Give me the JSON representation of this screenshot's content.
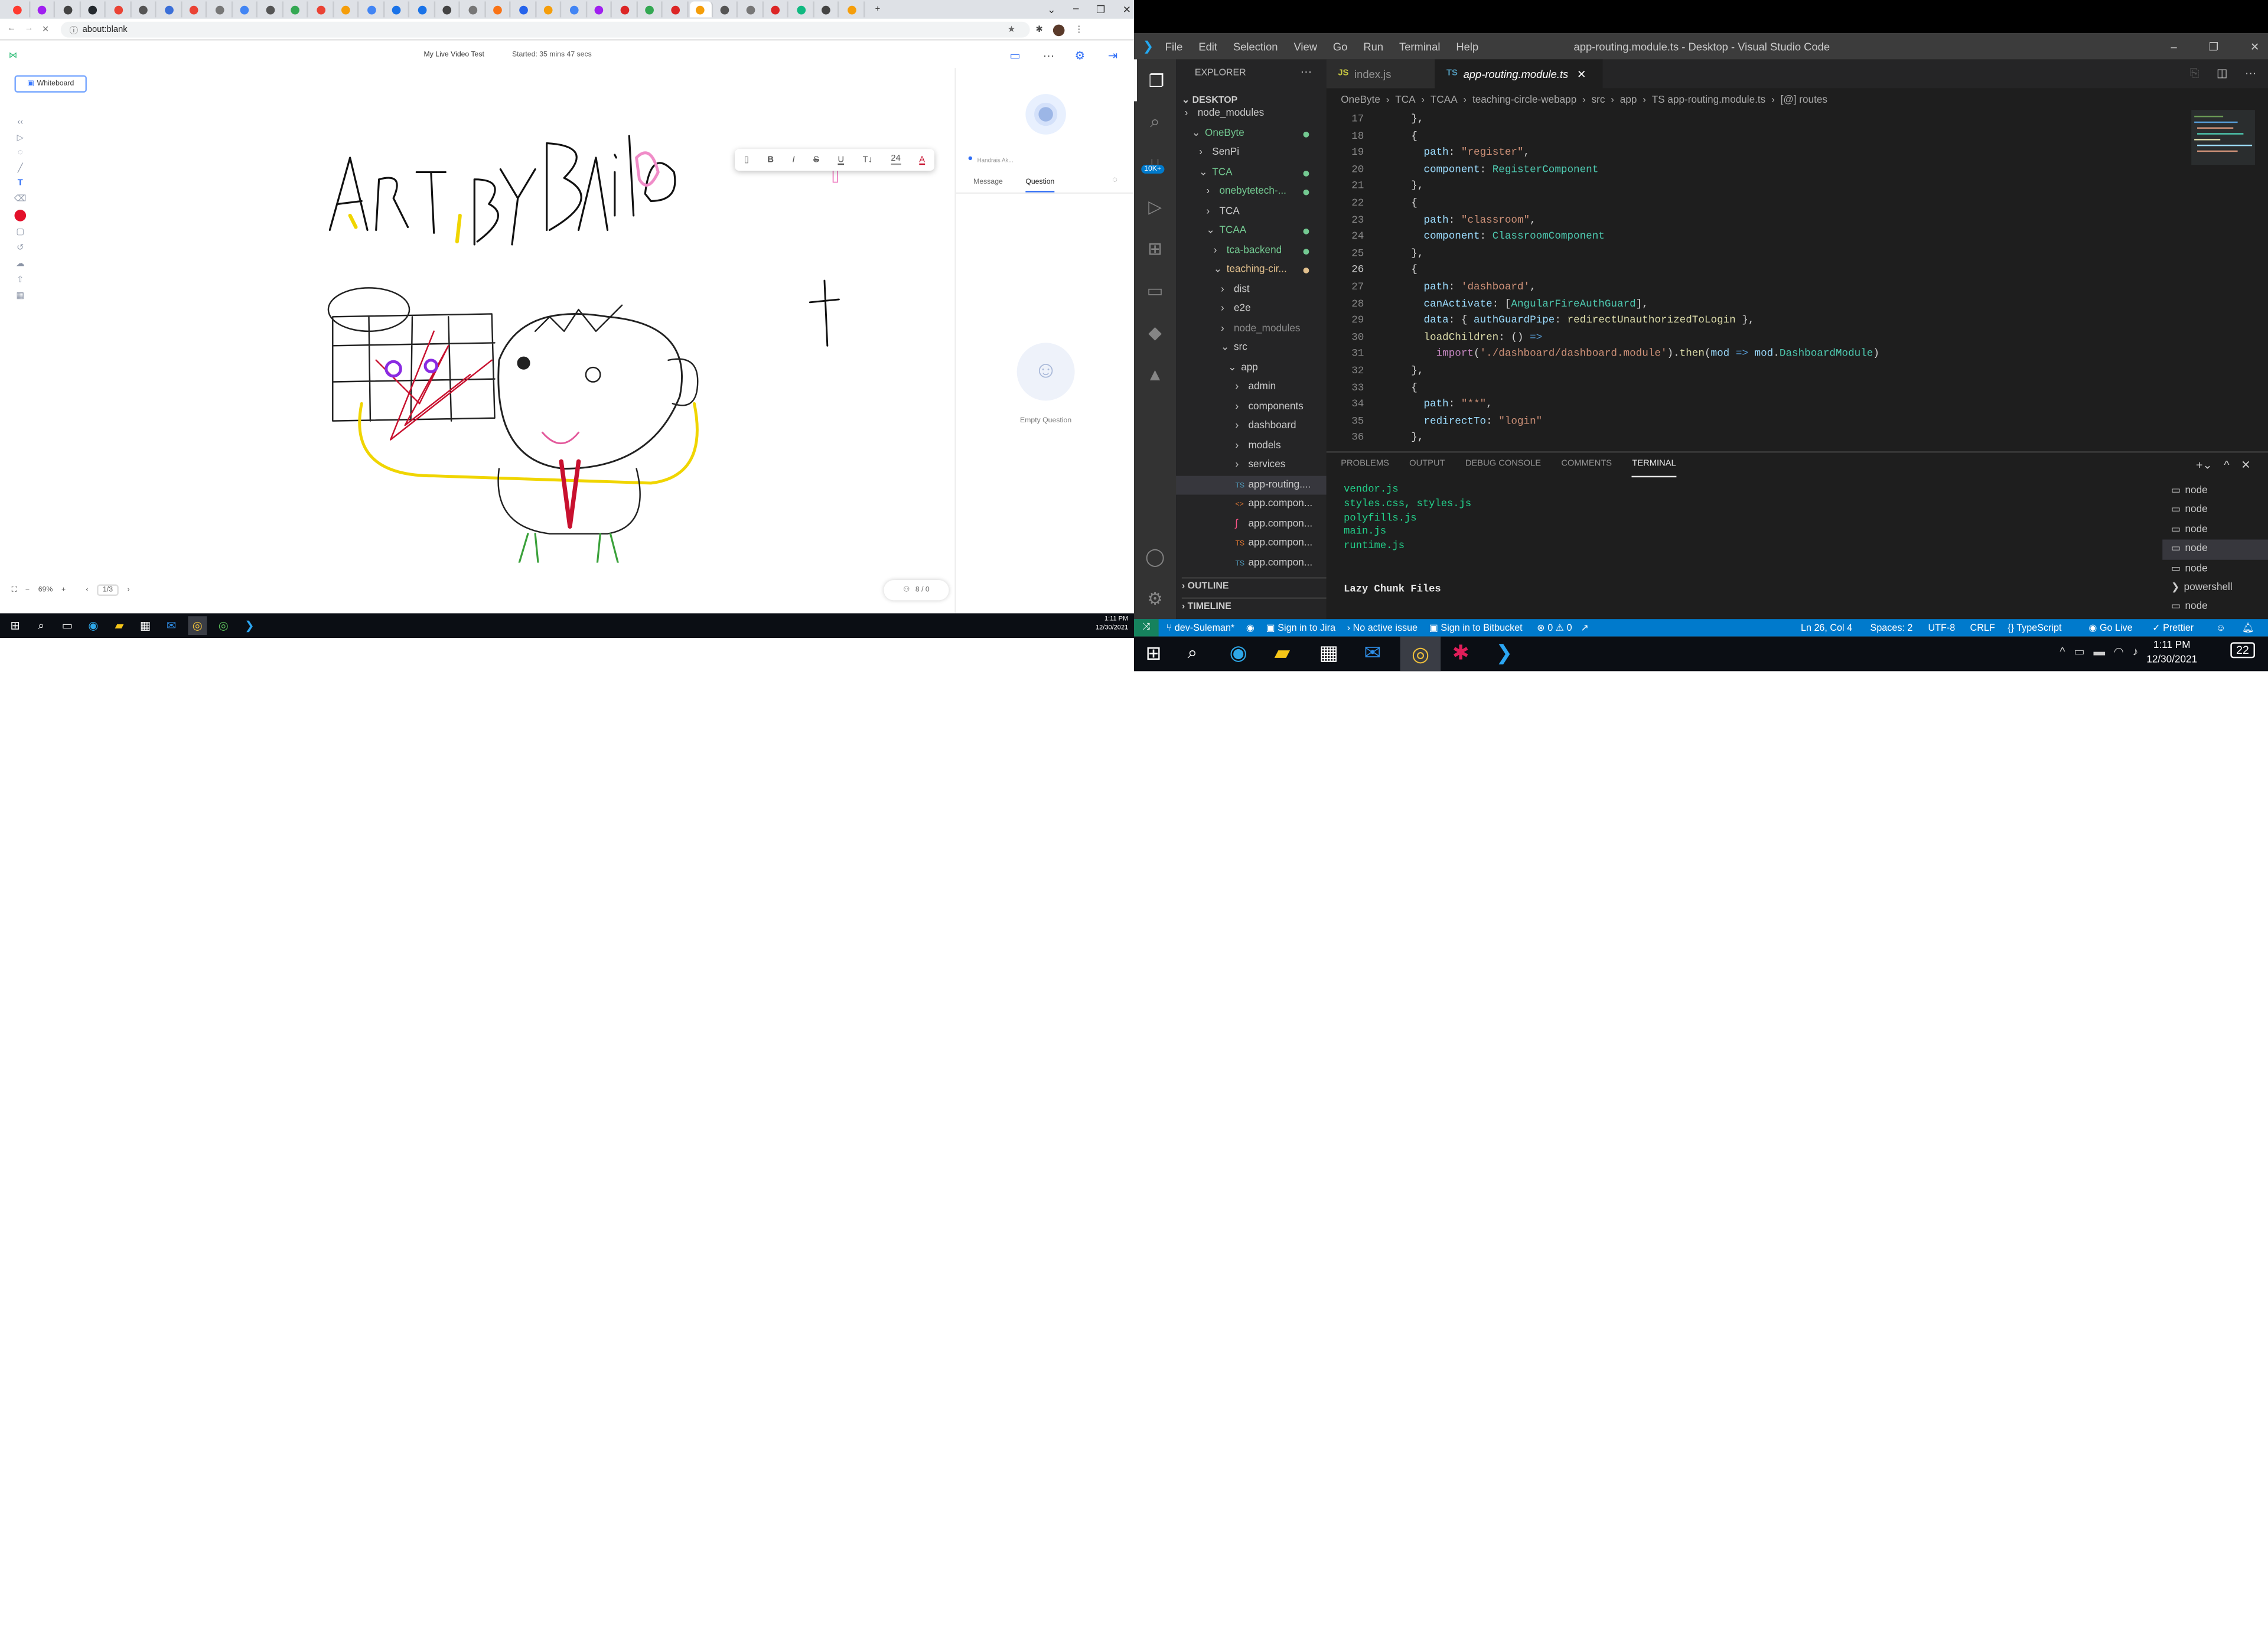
{
  "browser": {
    "window_controls": [
      "–",
      "❐",
      "✕"
    ],
    "new_tab": "+",
    "url": "about:blank"
  },
  "classroom": {
    "title": "My Live Video Test",
    "started": "Started: 35 mins 47 secs",
    "whiteboard_tag": "Whiteboard",
    "font_size": "24",
    "format_buttons": [
      "B",
      "I",
      "S",
      "U",
      "T↓"
    ],
    "raise_hand_placeholder": "Handrais Ak...",
    "tabs": [
      "Message",
      "Question"
    ],
    "empty_question": "Empty Question",
    "zoom": "69%",
    "page": "1/3",
    "users": "8 / 0",
    "drawing_text": "ArT By Bailo"
  },
  "left_taskbar": {
    "time": "1:11 PM",
    "date": "12/30/2021"
  },
  "vscode": {
    "menu": [
      "File",
      "Edit",
      "Selection",
      "View",
      "Go",
      "Run",
      "Terminal",
      "Help"
    ],
    "title": "app-routing.module.ts - Desktop - Visual Studio Code",
    "explorer_title": "EXPLORER",
    "badge": "10K+",
    "tree": [
      {
        "label": "node_modules",
        "indent": 0,
        "arrow": "›",
        "color": "#cccccc"
      },
      {
        "label": "OneByte",
        "indent": 1,
        "arrow": "⌄",
        "color": "#73c991",
        "dot": true
      },
      {
        "label": "SenPi",
        "indent": 2,
        "arrow": "›",
        "color": "#cccccc"
      },
      {
        "label": "TCA",
        "indent": 2,
        "arrow": "⌄",
        "color": "#73c991",
        "dot": true
      },
      {
        "label": "onebytetech-...",
        "indent": 3,
        "arrow": "›",
        "color": "#73c991",
        "dot": true
      },
      {
        "label": "TCA",
        "indent": 3,
        "arrow": "›",
        "color": "#cccccc"
      },
      {
        "label": "TCAA",
        "indent": 3,
        "arrow": "⌄",
        "color": "#73c991",
        "dot": true
      },
      {
        "label": "tca-backend",
        "indent": 4,
        "arrow": "›",
        "color": "#73c991",
        "dot": true
      },
      {
        "label": "teaching-cir...",
        "indent": 4,
        "arrow": "⌄",
        "color": "#e2c08d",
        "dot": true,
        "dotcolor": "#e2c08d"
      },
      {
        "label": "dist",
        "indent": 5,
        "arrow": "›",
        "color": "#cccccc"
      },
      {
        "label": "e2e",
        "indent": 5,
        "arrow": "›",
        "color": "#cccccc"
      },
      {
        "label": "node_modules",
        "indent": 5,
        "arrow": "›",
        "color": "#8c8c8c"
      },
      {
        "label": "src",
        "indent": 5,
        "arrow": "⌄",
        "color": "#cccccc"
      },
      {
        "label": "app",
        "indent": 6,
        "arrow": "⌄",
        "color": "#cccccc"
      },
      {
        "label": "admin",
        "indent": 7,
        "arrow": "›",
        "color": "#cccccc"
      },
      {
        "label": "components",
        "indent": 7,
        "arrow": "›",
        "color": "#cccccc"
      },
      {
        "label": "dashboard",
        "indent": 7,
        "arrow": "›",
        "color": "#cccccc"
      },
      {
        "label": "models",
        "indent": 7,
        "arrow": "›",
        "color": "#cccccc"
      },
      {
        "label": "services",
        "indent": 7,
        "arrow": "›",
        "color": "#cccccc"
      },
      {
        "label": "app-routing....",
        "indent": 7,
        "arrow": "TS",
        "color": "#cccccc",
        "icon_color": "#519aba",
        "selected": true
      },
      {
        "label": "app.compon...",
        "indent": 7,
        "arrow": "<>",
        "color": "#cccccc",
        "icon_color": "#e37933"
      },
      {
        "label": "app.compon...",
        "indent": 7,
        "arrow": "ʃ",
        "color": "#cccccc",
        "icon_color": "#f55385"
      },
      {
        "label": "app.compon...",
        "indent": 7,
        "arrow": "TS",
        "color": "#cccccc",
        "icon_color": "#e37933"
      },
      {
        "label": "app.compon...",
        "indent": 7,
        "arrow": "TS",
        "color": "#cccccc",
        "icon_color": "#519aba"
      }
    ],
    "root_label": "DESKTOP",
    "outline": "OUTLINE",
    "timeline": "TIMELINE",
    "tabs": [
      {
        "icon": "JS",
        "label": "index.js",
        "active": false
      },
      {
        "icon": "TS",
        "label": "app-routing.module.ts",
        "active": true
      }
    ],
    "breadcrumbs": [
      "OneByte",
      "TCA",
      "TCAA",
      "teaching-circle-webapp",
      "src",
      "app",
      "TS app-routing.module.ts",
      "[@] routes"
    ],
    "code": [
      {
        "n": "17",
        "t": [
          [
            "  },",
            "#d4d4d4"
          ]
        ]
      },
      {
        "n": "18",
        "t": [
          [
            "  {",
            "#d4d4d4"
          ]
        ]
      },
      {
        "n": "19",
        "t": [
          [
            "    ",
            "#d4d4d4"
          ],
          [
            "path",
            "#9cdcfe"
          ],
          [
            ": ",
            "#d4d4d4"
          ],
          [
            "\"register\"",
            "#ce9178"
          ],
          [
            ",",
            "#d4d4d4"
          ]
        ]
      },
      {
        "n": "20",
        "t": [
          [
            "    ",
            "#d4d4d4"
          ],
          [
            "component",
            "#9cdcfe"
          ],
          [
            ": ",
            "#d4d4d4"
          ],
          [
            "RegisterComponent",
            "#4ec9b0"
          ]
        ]
      },
      {
        "n": "21",
        "t": [
          [
            "  },",
            "#d4d4d4"
          ]
        ]
      },
      {
        "n": "22",
        "t": [
          [
            "  {",
            "#d4d4d4"
          ]
        ]
      },
      {
        "n": "23",
        "t": [
          [
            "    ",
            "#d4d4d4"
          ],
          [
            "path",
            "#9cdcfe"
          ],
          [
            ": ",
            "#d4d4d4"
          ],
          [
            "\"classroom\"",
            "#ce9178"
          ],
          [
            ",",
            "#d4d4d4"
          ]
        ]
      },
      {
        "n": "24",
        "t": [
          [
            "    ",
            "#d4d4d4"
          ],
          [
            "component",
            "#9cdcfe"
          ],
          [
            ": ",
            "#d4d4d4"
          ],
          [
            "ClassroomComponent",
            "#4ec9b0"
          ]
        ]
      },
      {
        "n": "25",
        "t": [
          [
            "  },",
            "#d4d4d4"
          ]
        ]
      },
      {
        "n": "26",
        "t": [
          [
            "  {",
            "#d4d4d4"
          ]
        ]
      },
      {
        "n": "27",
        "t": [
          [
            "    ",
            "#d4d4d4"
          ],
          [
            "path",
            "#9cdcfe"
          ],
          [
            ": ",
            "#d4d4d4"
          ],
          [
            "'dashboard'",
            "#ce9178"
          ],
          [
            ",",
            "#d4d4d4"
          ]
        ]
      },
      {
        "n": "28",
        "t": [
          [
            "    ",
            "#d4d4d4"
          ],
          [
            "canActivate",
            "#9cdcfe"
          ],
          [
            ": [",
            "#d4d4d4"
          ],
          [
            "AngularFireAuthGuard",
            "#4ec9b0"
          ],
          [
            "],",
            "#d4d4d4"
          ]
        ]
      },
      {
        "n": "29",
        "t": [
          [
            "    ",
            "#d4d4d4"
          ],
          [
            "data",
            "#9cdcfe"
          ],
          [
            ": { ",
            "#d4d4d4"
          ],
          [
            "authGuardPipe",
            "#9cdcfe"
          ],
          [
            ": ",
            "#d4d4d4"
          ],
          [
            "redirectUnauthorizedToLogin",
            "#dcdcaa"
          ],
          [
            " },",
            "#d4d4d4"
          ]
        ]
      },
      {
        "n": "30",
        "t": [
          [
            "    ",
            "#d4d4d4"
          ],
          [
            "loadChildren",
            "#dcdcaa"
          ],
          [
            ": () ",
            "#d4d4d4"
          ],
          [
            "=>",
            "#569cd6"
          ]
        ]
      },
      {
        "n": "31",
        "t": [
          [
            "      ",
            "#d4d4d4"
          ],
          [
            "import",
            "#c586c0"
          ],
          [
            "(",
            "#d4d4d4"
          ],
          [
            "'./dashboard/dashboard.module'",
            "#ce9178"
          ],
          [
            ").",
            "#d4d4d4"
          ],
          [
            "then",
            "#dcdcaa"
          ],
          [
            "(",
            "#d4d4d4"
          ],
          [
            "mod",
            "#9cdcfe"
          ],
          [
            " => ",
            "#569cd6"
          ],
          [
            "mod",
            "#9cdcfe"
          ],
          [
            ".",
            "#d4d4d4"
          ],
          [
            "DashboardModule",
            "#4ec9b0"
          ],
          [
            ")",
            "#d4d4d4"
          ]
        ]
      },
      {
        "n": "32",
        "t": [
          [
            "  },",
            "#d4d4d4"
          ]
        ]
      },
      {
        "n": "33",
        "t": [
          [
            "  {",
            "#d4d4d4"
          ]
        ]
      },
      {
        "n": "34",
        "t": [
          [
            "    ",
            "#d4d4d4"
          ],
          [
            "path",
            "#9cdcfe"
          ],
          [
            ": ",
            "#d4d4d4"
          ],
          [
            "\"**\"",
            "#ce9178"
          ],
          [
            ",",
            "#d4d4d4"
          ]
        ]
      },
      {
        "n": "35",
        "t": [
          [
            "    ",
            "#d4d4d4"
          ],
          [
            "redirectTo",
            "#9cdcfe"
          ],
          [
            ": ",
            "#d4d4d4"
          ],
          [
            "\"login\"",
            "#ce9178"
          ]
        ]
      },
      {
        "n": "36",
        "t": [
          [
            "  },",
            "#d4d4d4"
          ]
        ]
      }
    ],
    "panel_tabs": [
      "PROBLEMS",
      "OUTPUT",
      "DEBUG CONSOLE",
      "COMMENTS",
      "TERMINAL"
    ],
    "terminal_lines": [
      "vendor.js",
      "styles.css, styles.js",
      "polyfills.js",
      "main.js",
      "runtime.js",
      "",
      "",
      "Lazy Chunk Files"
    ],
    "terminals": [
      "node",
      "node",
      "node",
      "node",
      "node",
      "powershell",
      "node"
    ],
    "status": {
      "branch": "dev-Suleman*",
      "jira": "Sign in to Jira",
      "issue": "No active issue",
      "bitbucket": "Sign in to Bitbucket",
      "problems": "⊗ 0 ⚠ 0",
      "position": "Ln 26, Col 4",
      "spaces": "Spaces: 2",
      "encoding": "UTF-8",
      "eol": "CRLF",
      "language": "{} TypeScript",
      "golive": "Go Live",
      "prettier": "✓ Prettier"
    }
  },
  "right_taskbar": {
    "time": "1:11 PM",
    "date": "12/30/2021",
    "notif": "22"
  }
}
